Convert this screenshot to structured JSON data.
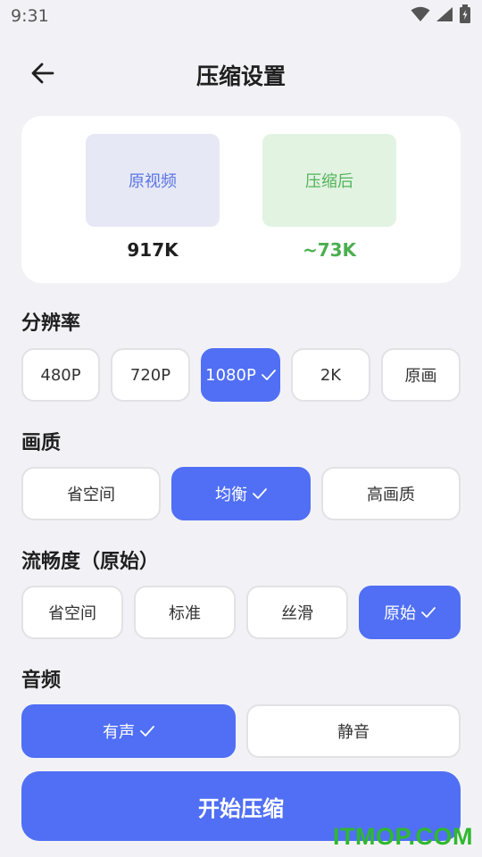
{
  "status_bar": {
    "time": "9:31"
  },
  "header": {
    "title": "压缩设置"
  },
  "preview": {
    "original_label": "原视频",
    "original_size": "917K",
    "compressed_label": "压缩后",
    "compressed_size": "~73K"
  },
  "resolution": {
    "label": "分辨率",
    "options": [
      "480P",
      "720P",
      "1080P",
      "2K",
      "原画"
    ],
    "selected": "1080P"
  },
  "quality": {
    "label": "画质",
    "options": [
      "省空间",
      "均衡",
      "高画质"
    ],
    "selected": "均衡"
  },
  "fluency": {
    "label": "流畅度（原始）",
    "options": [
      "省空间",
      "标准",
      "丝滑",
      "原始"
    ],
    "selected": "原始"
  },
  "audio": {
    "label": "音频",
    "options": [
      "有声",
      "静音"
    ],
    "selected": "有声"
  },
  "start_button": {
    "label": "开始压缩"
  },
  "watermark": "ITMOP.COM",
  "colors": {
    "accent": "#506ff5",
    "success": "#4caf50",
    "background": "#f2f2f6"
  },
  "icons": [
    "wifi-icon",
    "signal-icon",
    "battery-icon",
    "back-arrow-icon",
    "check-icon"
  ]
}
